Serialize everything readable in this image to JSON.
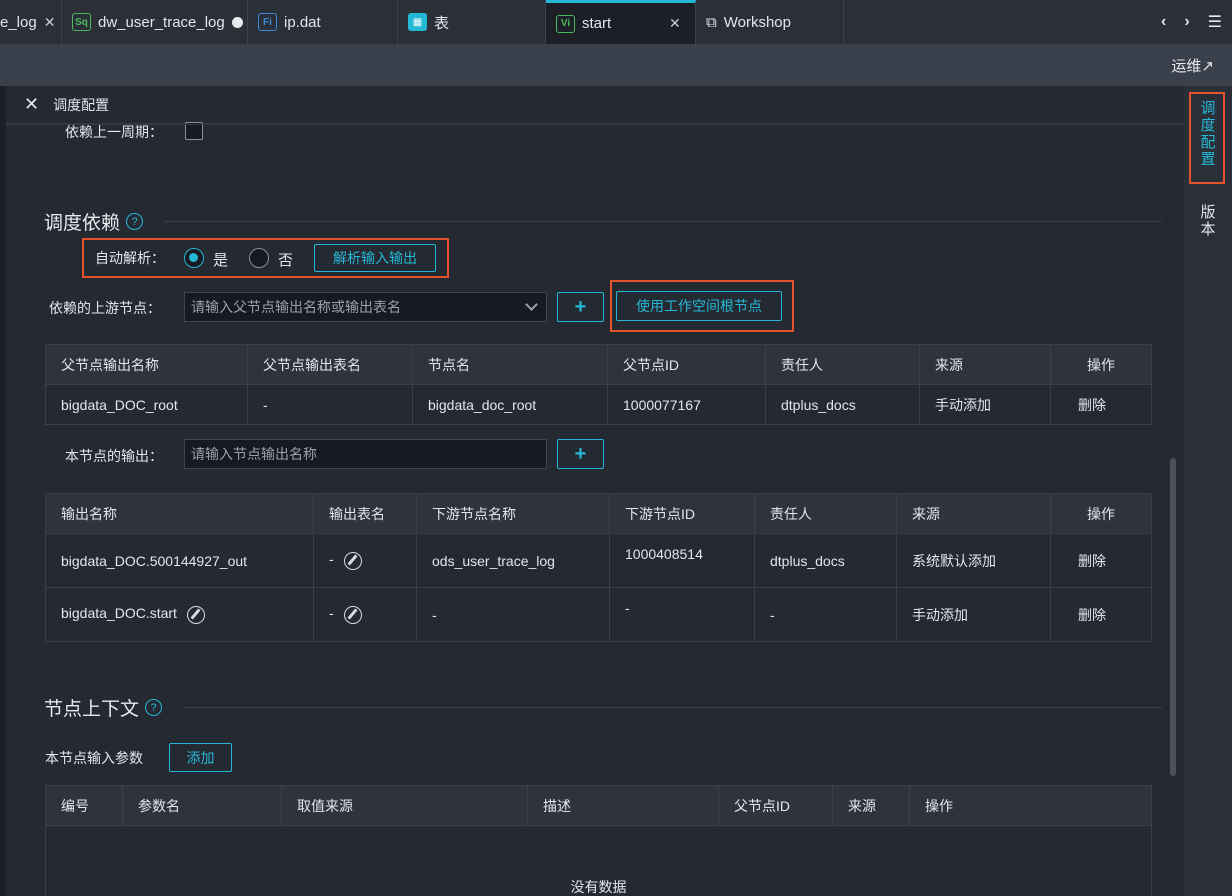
{
  "tabs": [
    {
      "label": "e_log",
      "icon": "",
      "active": false
    },
    {
      "label": "dw_user_trace_log",
      "icon": "Sq",
      "active": false
    },
    {
      "label": "ip.dat",
      "icon": "Fi",
      "active": false
    },
    {
      "label": "表",
      "icon": "",
      "active": false
    },
    {
      "label": "start",
      "icon": "Vi",
      "active": true
    },
    {
      "label": "Workshop",
      "icon": "",
      "active": false
    }
  ],
  "toolbar": {
    "ops_label": "运维↗"
  },
  "panel": {
    "title": "调度配置"
  },
  "rightbar": {
    "items": [
      {
        "label": "调度配置"
      },
      {
        "label": "版本"
      }
    ]
  },
  "prev_cycle": {
    "label": "依赖上一周期："
  },
  "dependency": {
    "title": "调度依赖",
    "auto_parse_label": "自动解析：",
    "yes": "是",
    "no": "否",
    "parse_button": "解析输入输出",
    "upstream_label": "依赖的上游节点：",
    "upstream_placeholder": "请输入父节点输出名称或输出表名",
    "add_button": "+",
    "root_button": "使用工作空间根节点",
    "upstream_table": {
      "headers": [
        "父节点输出名称",
        "父节点输出表名",
        "节点名",
        "父节点ID",
        "责任人",
        "来源",
        "操作"
      ],
      "rows": [
        [
          "bigdata_DOC_root",
          "-",
          "bigdata_doc_root",
          "1000077167",
          "dtplus_docs",
          "手动添加",
          "删除"
        ]
      ]
    },
    "output_label": "本节点的输出：",
    "output_placeholder": "请输入节点输出名称",
    "output_table": {
      "headers": [
        "输出名称",
        "输出表名",
        "下游节点名称",
        "下游节点ID",
        "责任人",
        "来源",
        "操作"
      ],
      "rows": [
        [
          "bigdata_DOC.500144927_out",
          "-",
          "ods_user_trace_log",
          "1000408514",
          "dtplus_docs",
          "系统默认添加",
          "删除"
        ],
        [
          "bigdata_DOC.start",
          "-",
          "-",
          "-",
          "-",
          "手动添加",
          "删除"
        ]
      ]
    }
  },
  "context": {
    "title": "节点上下文",
    "input_params_label": "本节点输入参数",
    "add_button": "添加",
    "table": {
      "headers": [
        "编号",
        "参数名",
        "取值来源",
        "描述",
        "父节点ID",
        "来源",
        "操作"
      ],
      "empty_text": "没有数据"
    }
  }
}
